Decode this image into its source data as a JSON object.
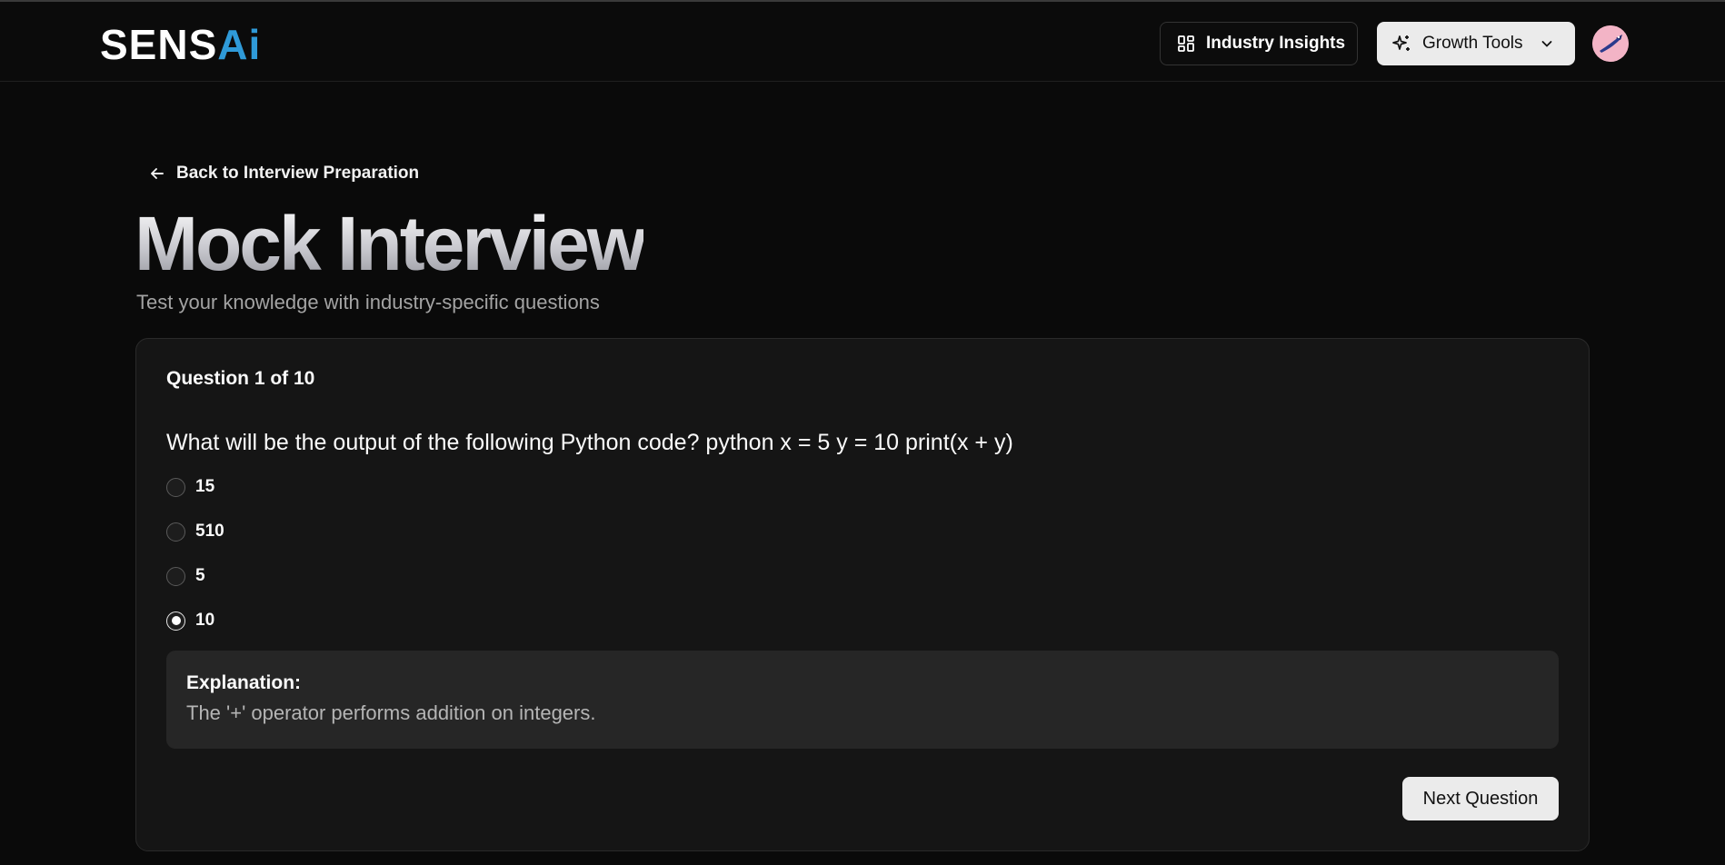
{
  "header": {
    "logo_part1": "SENS",
    "logo_part2": "Ai",
    "industry_insights_label": "Industry Insights",
    "growth_tools_label": "Growth Tools",
    "icons": {
      "insights": "grid-icon",
      "growth": "sparkle-icon",
      "dropdown": "chevron-down-icon",
      "avatar": "bird-avatar"
    }
  },
  "nav": {
    "back_label": "Back to Interview Preparation",
    "back_icon": "arrow-left-icon"
  },
  "page": {
    "title": "Mock Interview",
    "subtitle": "Test your knowledge with industry-specific questions"
  },
  "quiz": {
    "counter": "Question 1 of 10",
    "question": "What will be the output of the following Python code? python x = 5 y = 10 print(x + y)",
    "options": [
      {
        "label": "15",
        "selected": false
      },
      {
        "label": "510",
        "selected": false
      },
      {
        "label": "5",
        "selected": false
      },
      {
        "label": "10",
        "selected": true
      }
    ],
    "explanation_title": "Explanation:",
    "explanation_text": "The '+' operator performs addition on integers.",
    "next_label": "Next Question"
  },
  "colors": {
    "background": "#0a0a0a",
    "card": "#151515",
    "accent_logo": "#2f9ad8",
    "button_light": "#ebebeb"
  }
}
